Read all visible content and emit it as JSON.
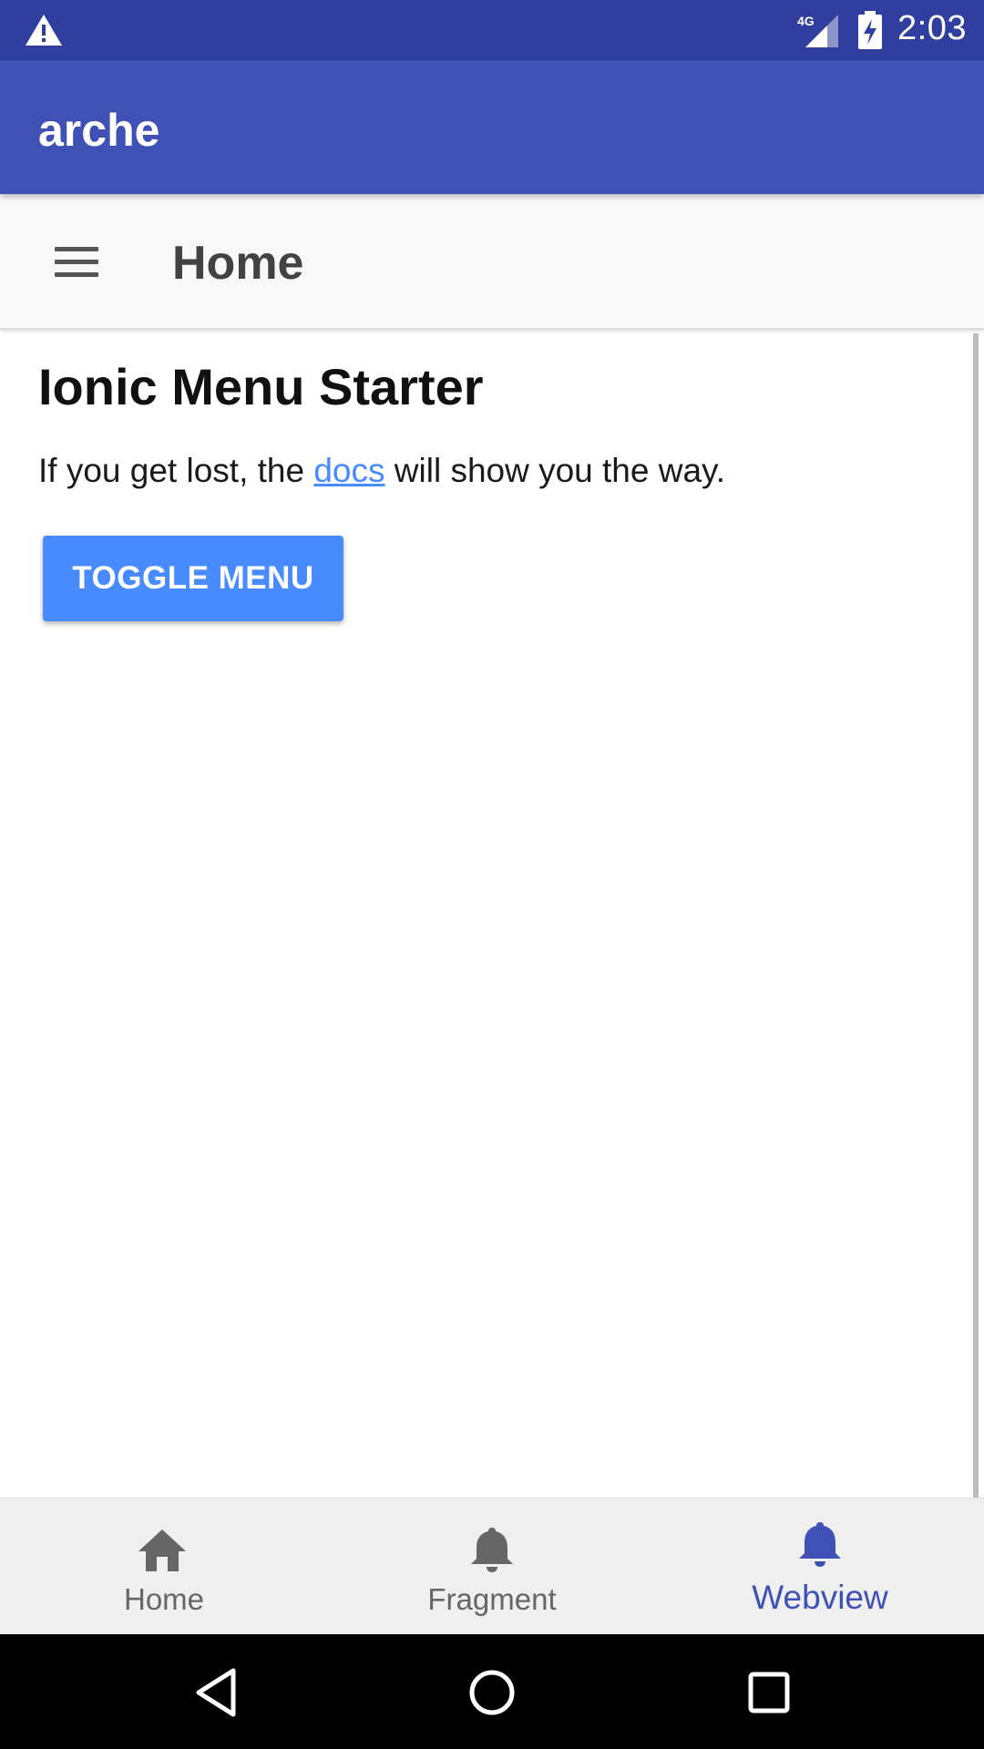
{
  "status_bar": {
    "time": "2:03",
    "network": "4G",
    "icons": [
      "warning-icon",
      "signal-4g-icon",
      "battery-charging-icon"
    ]
  },
  "app_bar": {
    "title": "arche"
  },
  "toolbar": {
    "title": "Home",
    "menu_icon": "hamburger-menu-icon"
  },
  "content": {
    "heading": "Ionic Menu Starter",
    "text_before": "If you get lost, the ",
    "link_text": "docs",
    "text_after": " will show you the way.",
    "button_label": "TOGGLE MENU"
  },
  "bottom_nav": {
    "items": [
      {
        "label": "Home",
        "icon": "home-icon",
        "active": false
      },
      {
        "label": "Fragment",
        "icon": "bell-icon",
        "active": false
      },
      {
        "label": "Webview",
        "icon": "bell-icon",
        "active": true
      }
    ]
  },
  "system_nav": {
    "icons": [
      "back-icon",
      "home-circle-icon",
      "recents-icon"
    ]
  },
  "colors": {
    "status_bar": "#303f9f",
    "app_bar": "#3f51b5",
    "primary_button": "#488aff",
    "link": "#488aff",
    "active_nav": "#3f51b5",
    "inactive_nav": "#666666"
  }
}
